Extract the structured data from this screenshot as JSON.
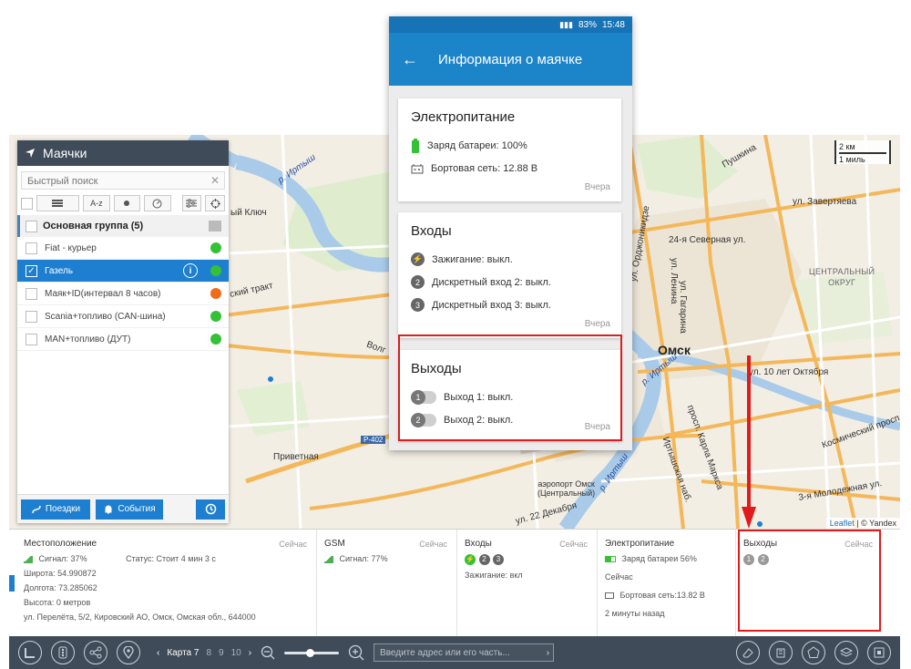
{
  "trackers": {
    "title": "Маячки",
    "search_placeholder": "Быстрый поиск",
    "sort_label": "A-z",
    "group": "Основная группа (5)",
    "items": [
      {
        "name": "Fiat - курьер",
        "status_color": "#35c135"
      },
      {
        "name": "Газель",
        "status_color": "#35c135",
        "selected": true
      },
      {
        "name": "Маяк+ID(интервал 8 часов)",
        "status_color": "#ef6c1a"
      },
      {
        "name": "Scania+топливо (CAN-шина)",
        "status_color": "#35c135"
      },
      {
        "name": "MAN+топливо (ДУТ)",
        "status_color": "#35c135"
      }
    ],
    "trips_button": "Поездки",
    "events_button": "События"
  },
  "map": {
    "city": "Омск",
    "labels": {
      "river1": "р. Иртыш",
      "river2": "р. Иртыш",
      "river3": "р. Иртыш",
      "tract": "ский тракт",
      "klyuch": "ый Ключ",
      "privetnaya": "Приветная",
      "volgo": "Волг",
      "p402": "Р-402",
      "airport": "аэропорт Омск\n(Центральный)",
      "pushkina": "Пушкина",
      "zavertyaeva": "ул. Завертяева",
      "severnaya": "24-я Северная ул.",
      "oktyabrya": "ул. 10 лет Октября",
      "district": "ЦЕНТРАЛЬНЫЙ\nОКРУГ",
      "ordzhonikidze": "ул. Орджоникидзе",
      "marksa": "просп. Карла Маркса",
      "irtyshskaya": "Иртышская наб.",
      "kosmichesky": "Космический просп.",
      "molodezhnaya": "3-я Молодежная ул.",
      "dekabristov": "ул. 22 Декабря",
      "gagarina": "ул. Гагарина",
      "lenina": "ул. Ленина"
    },
    "scale_km": "2 км",
    "scale_mi": "1 миль",
    "attribution_leaflet": "Leaflet",
    "attribution_rest": "| © Yandex"
  },
  "infobar": {
    "location": {
      "title": "Местоположение",
      "now": "Сейчас",
      "signal": "Сигнал: 37%",
      "status": "Статус: Стоит 4 мин 3 с",
      "lat": "Широта: 54.990872",
      "lon": "Долгота: 73.285062",
      "alt": "Высота: 0 метров",
      "address": "ул. Перелёта, 5/2, Кировский АО, Омск, Омская обл., 644000"
    },
    "gsm": {
      "title": "GSM",
      "now": "Сейчас",
      "signal": "Сигнал: 77%"
    },
    "inputs": {
      "title": "Входы",
      "now": "Сейчас",
      "badges": [
        "⚡",
        "2",
        "3"
      ],
      "ignition": "Зажигание: вкл"
    },
    "power": {
      "title": "Электропитание",
      "battery": "Заряд батареи 56%",
      "now_label": "Сейчас",
      "board": "Бортовая сеть:13.82 В",
      "ago": "2 минуты назад"
    },
    "outputs": {
      "title": "Выходы",
      "now": "Сейчас",
      "badges": [
        "1",
        "2"
      ]
    }
  },
  "bottombar": {
    "map_label": "Карта 7",
    "pages": [
      "8",
      "9",
      "10"
    ],
    "address_placeholder": "Введите адрес или его часть..."
  },
  "phone": {
    "status_text": "83%",
    "time": "15:48",
    "title": "Информация о маячке",
    "power": {
      "title": "Электропитание",
      "battery": "Заряд батареи: 100%",
      "board": "Бортовая сеть: 12.88 В",
      "when": "Вчера"
    },
    "inputs": {
      "title": "Входы",
      "ignition": "Зажигание: выкл.",
      "in2": "Дискретный вход 2: выкл.",
      "in3": "Дискретный вход 3: выкл.",
      "when": "Вчера"
    },
    "outputs": {
      "title": "Выходы",
      "out1": "Выход 1: выкл.",
      "out2": "Выход 2: выкл.",
      "when": "Вчера"
    }
  },
  "colors": {
    "accent": "#1e7fd0",
    "dark": "#3f4b59",
    "highlight": "#e11b1b",
    "green": "#35c135",
    "orange": "#ef6c1a"
  }
}
